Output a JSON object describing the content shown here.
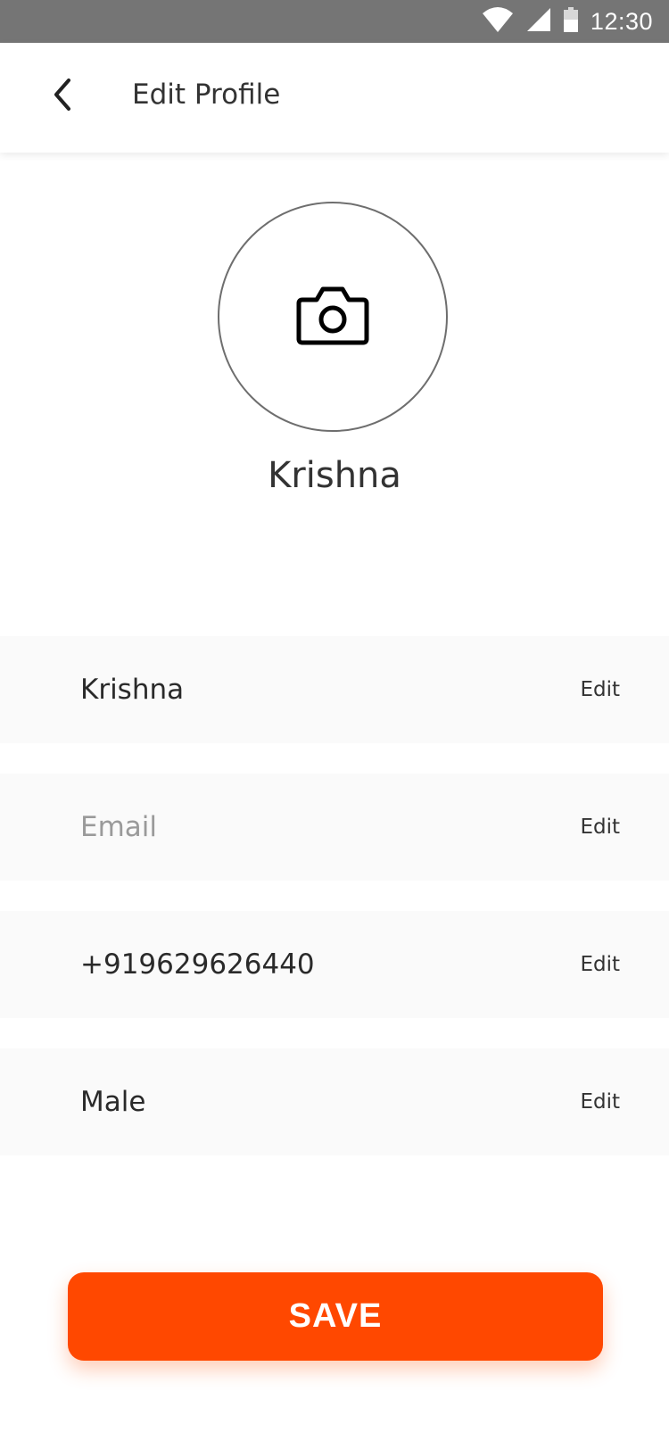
{
  "status_bar": {
    "time": "12:30",
    "icons": [
      "wifi-icon",
      "signal-icon",
      "battery-icon"
    ]
  },
  "header": {
    "back_icon": "chevron-left-icon",
    "title": "Edit Profile"
  },
  "profile": {
    "avatar_icon": "camera-icon",
    "name": "Krishna"
  },
  "fields": [
    {
      "value": "Krishna",
      "placeholder": "",
      "edit_label": "Edit"
    },
    {
      "value": "",
      "placeholder": "Email",
      "edit_label": "Edit"
    },
    {
      "value": "+919629626440",
      "placeholder": "",
      "edit_label": "Edit"
    },
    {
      "value": "Male",
      "placeholder": "",
      "edit_label": "Edit"
    }
  ],
  "save_button": {
    "label": "SAVE"
  },
  "colors": {
    "accent": "#FF4800",
    "status_bar": "#757575",
    "field_background": "#FAFAFA",
    "placeholder": "#9A9A9A"
  }
}
